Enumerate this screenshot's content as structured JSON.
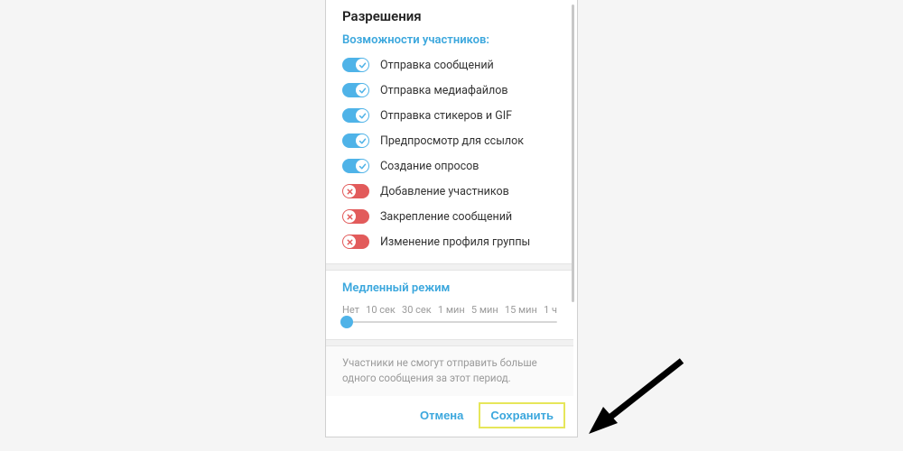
{
  "title": "Разрешения",
  "subtitle": "Возможности участников:",
  "permissions": [
    {
      "label": "Отправка сообщений",
      "on": true
    },
    {
      "label": "Отправка медиафайлов",
      "on": true
    },
    {
      "label": "Отправка стикеров и GIF",
      "on": true
    },
    {
      "label": "Предпросмотр для ссылок",
      "on": true
    },
    {
      "label": "Создание опросов",
      "on": true
    },
    {
      "label": "Добавление участников",
      "on": false
    },
    {
      "label": "Закрепление сообщений",
      "on": false
    },
    {
      "label": "Изменение профиля группы",
      "on": false
    }
  ],
  "slowmode": {
    "title": "Медленный режим",
    "labels": [
      "Нет",
      "10 сек",
      "30 сек",
      "1 мин",
      "5 мин",
      "15 мин",
      "1 ч"
    ],
    "help": "Участники не смогут отправить больше одного сообщения за этот период."
  },
  "footer": {
    "cancel": "Отмена",
    "save": "Сохранить"
  }
}
